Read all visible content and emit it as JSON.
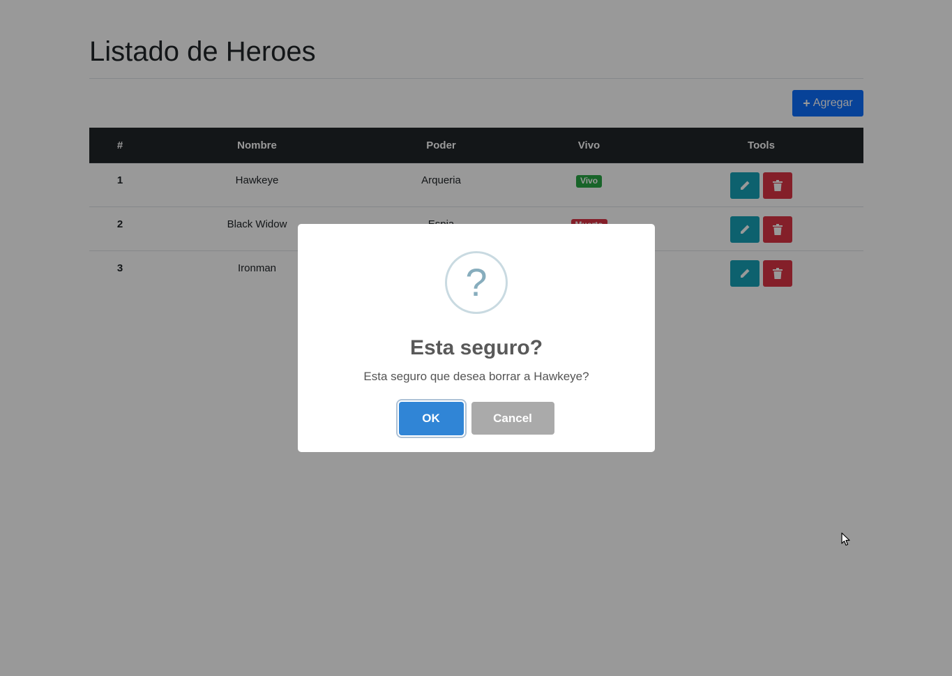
{
  "page": {
    "title": "Listado de Heroes",
    "add_button_label": "Agregar"
  },
  "table": {
    "headers": [
      "#",
      "Nombre",
      "Poder",
      "Vivo",
      "Tools"
    ],
    "rows": [
      {
        "num": "1",
        "nombre": "Hawkeye",
        "poder": "Arqueria",
        "vivo": "Vivo",
        "vivo_color": "#28a745"
      },
      {
        "num": "2",
        "nombre": "Black Widow",
        "poder": "Espia",
        "vivo": "Muerto",
        "vivo_color": "#dc3545"
      },
      {
        "num": "3",
        "nombre": "Ironman",
        "poder": "",
        "vivo": "",
        "vivo_color": ""
      }
    ]
  },
  "dialog": {
    "icon": "?",
    "title": "Esta seguro?",
    "text": "Esta seguro que desea borrar a Hawkeye?",
    "ok_label": "OK",
    "cancel_label": "Cancel"
  },
  "colors": {
    "primary": "#0d6efd",
    "edit": "#17a2b8",
    "delete": "#dc3545",
    "table_header": "#212529",
    "ok": "#3085d6",
    "cancel": "#aaaaaa"
  }
}
